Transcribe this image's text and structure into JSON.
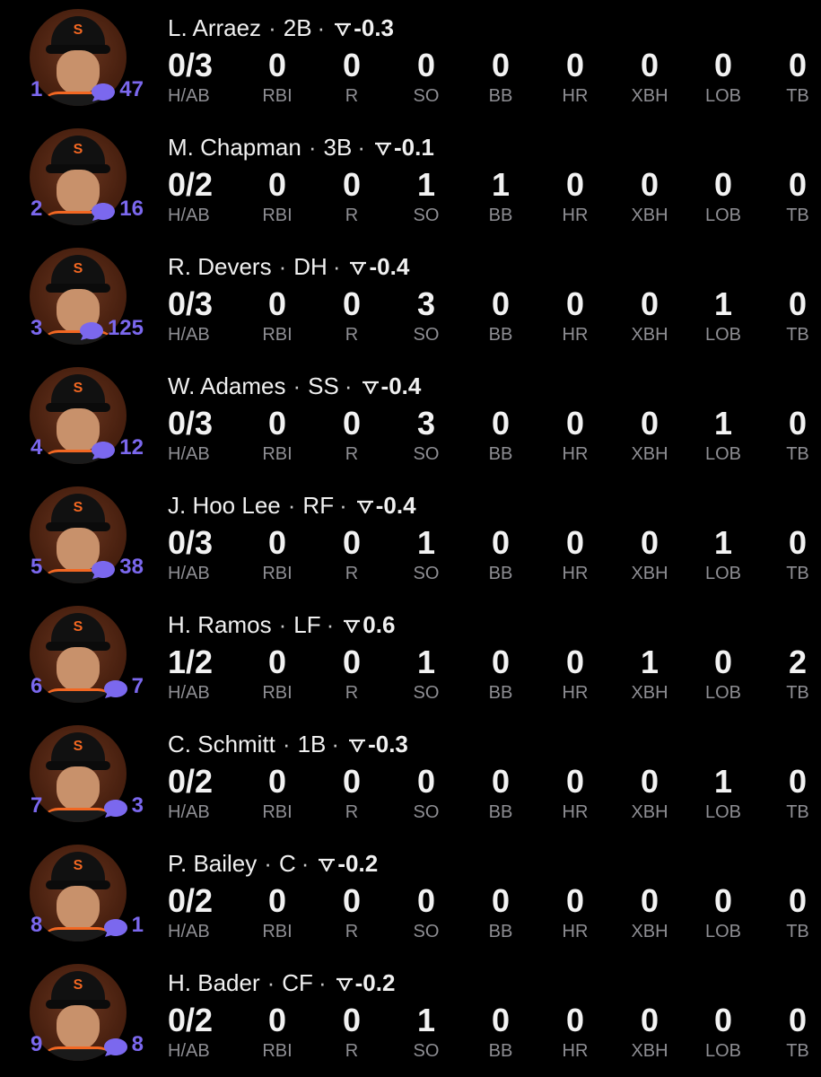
{
  "stat_labels": [
    "H/AB",
    "RBI",
    "R",
    "SO",
    "BB",
    "HR",
    "XBH",
    "LOB",
    "TB"
  ],
  "separator": "·",
  "colors": {
    "accent": "#7b68ee",
    "background": "#000000",
    "label": "#8e8e93",
    "avatar_bg": "#5a2a14"
  },
  "players": [
    {
      "order": "1",
      "comments": "47",
      "name": "L. Arraez",
      "position": "2B",
      "war": "-0.3",
      "stats": [
        "0/3",
        "0",
        "0",
        "0",
        "0",
        "0",
        "0",
        "0",
        "0"
      ]
    },
    {
      "order": "2",
      "comments": "16",
      "name": "M. Chapman",
      "position": "3B",
      "war": "-0.1",
      "stats": [
        "0/2",
        "0",
        "0",
        "1",
        "1",
        "0",
        "0",
        "0",
        "0"
      ]
    },
    {
      "order": "3",
      "comments": "125",
      "name": "R. Devers",
      "position": "DH",
      "war": "-0.4",
      "stats": [
        "0/3",
        "0",
        "0",
        "3",
        "0",
        "0",
        "0",
        "1",
        "0"
      ]
    },
    {
      "order": "4",
      "comments": "12",
      "name": "W. Adames",
      "position": "SS",
      "war": "-0.4",
      "stats": [
        "0/3",
        "0",
        "0",
        "3",
        "0",
        "0",
        "0",
        "1",
        "0"
      ]
    },
    {
      "order": "5",
      "comments": "38",
      "name": "J. Hoo Lee",
      "position": "RF",
      "war": "-0.4",
      "stats": [
        "0/3",
        "0",
        "0",
        "1",
        "0",
        "0",
        "0",
        "1",
        "0"
      ]
    },
    {
      "order": "6",
      "comments": "7",
      "name": "H. Ramos",
      "position": "LF",
      "war": "0.6",
      "stats": [
        "1/2",
        "0",
        "0",
        "1",
        "0",
        "0",
        "1",
        "0",
        "2"
      ]
    },
    {
      "order": "7",
      "comments": "3",
      "name": "C. Schmitt",
      "position": "1B",
      "war": "-0.3",
      "stats": [
        "0/2",
        "0",
        "0",
        "0",
        "0",
        "0",
        "0",
        "1",
        "0"
      ]
    },
    {
      "order": "8",
      "comments": "1",
      "name": "P. Bailey",
      "position": "C",
      "war": "-0.2",
      "stats": [
        "0/2",
        "0",
        "0",
        "0",
        "0",
        "0",
        "0",
        "0",
        "0"
      ]
    },
    {
      "order": "9",
      "comments": "8",
      "name": "H. Bader",
      "position": "CF",
      "war": "-0.2",
      "stats": [
        "0/2",
        "0",
        "0",
        "1",
        "0",
        "0",
        "0",
        "0",
        "0"
      ]
    }
  ]
}
